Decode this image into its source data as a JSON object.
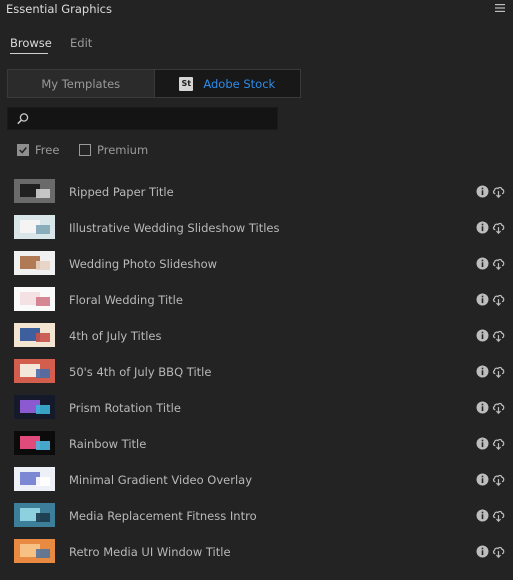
{
  "panel": {
    "title": "Essential Graphics"
  },
  "tabs": [
    {
      "label": "Browse",
      "active": true
    },
    {
      "label": "Edit",
      "active": false
    }
  ],
  "sources": {
    "my_templates": "My Templates",
    "adobe_stock_badge": "St",
    "adobe_stock": "Adobe Stock",
    "selected": "Adobe Stock"
  },
  "search": {
    "value": "",
    "placeholder": ""
  },
  "filters": [
    {
      "label": "Free",
      "checked": true
    },
    {
      "label": "Premium",
      "checked": false
    }
  ],
  "templates": [
    {
      "title": "Ripped Paper Title",
      "thumb": [
        "#6a6a6a",
        "#202020",
        "#cfcfcf"
      ]
    },
    {
      "title": "Illustrative Wedding Slideshow Titles",
      "thumb": [
        "#d8e6ea",
        "#f4f4f4",
        "#7fa5b5"
      ]
    },
    {
      "title": "Wedding Photo Slideshow",
      "thumb": [
        "#f1f1f1",
        "#b07a55",
        "#e7d2c2"
      ]
    },
    {
      "title": "Floral Wedding Title",
      "thumb": [
        "#fafafa",
        "#f3e1e3",
        "#d17a88"
      ]
    },
    {
      "title": "4th of July Titles",
      "thumb": [
        "#f3e5d2",
        "#3e5f9e",
        "#c8504a"
      ]
    },
    {
      "title": "50's 4th of July BBQ Title",
      "thumb": [
        "#d45e4d",
        "#f3e7d9",
        "#4a6da8"
      ]
    },
    {
      "title": "Prism Rotation Title",
      "thumb": [
        "#151a2a",
        "#8c5ad0",
        "#3ab3d6"
      ]
    },
    {
      "title": "Rainbow Title",
      "thumb": [
        "#0b0b0b",
        "#e04b7c",
        "#4bb6e0"
      ]
    },
    {
      "title": "Minimal Gradient Video Overlay",
      "thumb": [
        "#eef0f8",
        "#7c88d4",
        "#ffffff"
      ]
    },
    {
      "title": "Media Replacement Fitness Intro",
      "thumb": [
        "#3d7f9a",
        "#8dd0e0",
        "#1c3a4a"
      ]
    },
    {
      "title": "Retro Media UI Window Title",
      "thumb": [
        "#e98a43",
        "#f7c184",
        "#56739a"
      ]
    }
  ],
  "icons": {
    "panel_menu": "hamburger-icon",
    "search": "search-icon",
    "info": "info-icon",
    "download": "cloud-download-icon"
  },
  "colors": {
    "background": "#232323",
    "accent": "#2d8ceb",
    "text": "#b9b9b9"
  }
}
